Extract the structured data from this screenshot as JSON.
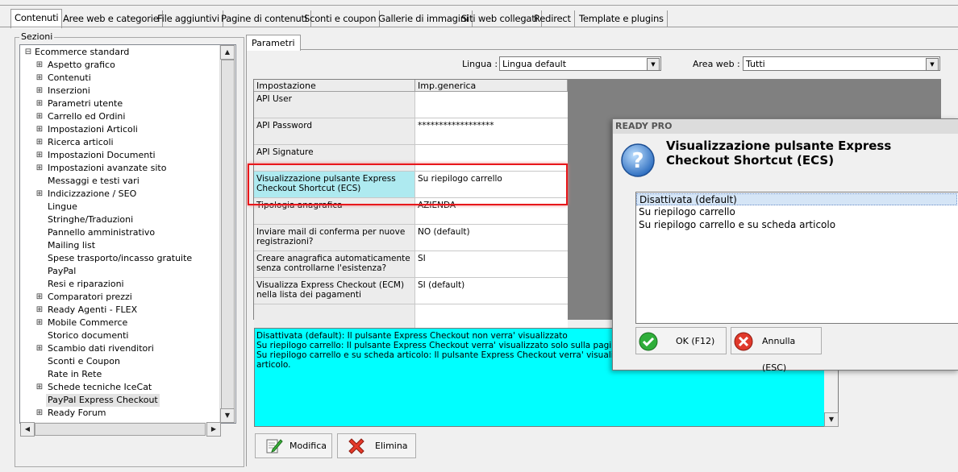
{
  "tabs": [
    "Contenuti",
    "Aree web e categorie",
    "File aggiuntivi",
    "Pagine di contenuti",
    "Sconti e coupon",
    "Gallerie di immagini",
    "Siti web collegati",
    "Redirect",
    "Template e plugins"
  ],
  "sections": {
    "label": "Sezioni",
    "root": "Ecommerce standard",
    "items": [
      {
        "label": "Aspetto grafico",
        "expandable": true
      },
      {
        "label": "Contenuti",
        "expandable": true
      },
      {
        "label": "Inserzioni",
        "expandable": true
      },
      {
        "label": "Parametri utente",
        "expandable": true
      },
      {
        "label": "Carrello ed Ordini",
        "expandable": true
      },
      {
        "label": "Impostazioni Articoli",
        "expandable": true
      },
      {
        "label": "Ricerca articoli",
        "expandable": true
      },
      {
        "label": "Impostazioni Documenti",
        "expandable": true
      },
      {
        "label": "Impostazioni avanzate sito",
        "expandable": true
      },
      {
        "label": "Messaggi e testi vari",
        "expandable": false
      },
      {
        "label": "Indicizzazione / SEO",
        "expandable": true
      },
      {
        "label": "Lingue",
        "expandable": false
      },
      {
        "label": "Stringhe/Traduzioni",
        "expandable": false
      },
      {
        "label": "Pannello amministrativo",
        "expandable": false
      },
      {
        "label": "Mailing list",
        "expandable": false
      },
      {
        "label": "Spese trasporto/incasso gratuite",
        "expandable": false
      },
      {
        "label": "PayPal",
        "expandable": false
      },
      {
        "label": "Resi e riparazioni",
        "expandable": false
      },
      {
        "label": "Comparatori prezzi",
        "expandable": true
      },
      {
        "label": "Ready Agenti - FLEX",
        "expandable": true
      },
      {
        "label": "Mobile Commerce",
        "expandable": true
      },
      {
        "label": "Storico documenti",
        "expandable": false
      },
      {
        "label": "Scambio dati rivenditori",
        "expandable": true
      },
      {
        "label": "Sconti e Coupon",
        "expandable": false
      },
      {
        "label": "Rate in Rete",
        "expandable": false
      },
      {
        "label": "Schede tecniche IceCat",
        "expandable": true
      },
      {
        "label": "PayPal Express Checkout",
        "expandable": false,
        "selected": true
      },
      {
        "label": "Ready Forum",
        "expandable": true
      }
    ]
  },
  "panel": {
    "tab": "Parametri",
    "lingua_label": "Lingua :",
    "lingua_value": "Lingua default",
    "area_label": "Area web :",
    "area_value": "Tutti"
  },
  "grid": {
    "headers": [
      "Impostazione",
      "Imp.generica"
    ],
    "rows": [
      {
        "name": "API User",
        "value": ""
      },
      {
        "name": "API Password",
        "value": "******************"
      },
      {
        "name": "API Signature",
        "value": ""
      },
      {
        "name": "Visualizzazione pulsante Express Checkout Shortcut (ECS)",
        "value": "Su riepilogo carrello",
        "selected": true
      },
      {
        "name": "Tipologia anagrafica",
        "value": "AZIENDA"
      },
      {
        "name": "Inviare mail di conferma per nuove registrazioni?",
        "value": "NO (default)"
      },
      {
        "name": "Creare anagrafica automaticamente senza controllarne l'esistenza?",
        "value": "SI"
      },
      {
        "name": "Visualizza Express Checkout (ECM) nella lista dei pagamenti",
        "value": "SI (default)"
      },
      {
        "name": "",
        "value": ""
      }
    ]
  },
  "memo": {
    "lines": [
      "Disattivata (default): Il pulsante Express Checkout non verra' visualizzato",
      "Su riepilogo carrello: Il pulsante Express Checkout verra' visualizzato solo sulla pagina di riep",
      "Su riepilogo carrello e su scheda articolo: Il pulsante Express Checkout verra' visualizzato so",
      "articolo."
    ]
  },
  "buttons": {
    "modifica": "Modifica",
    "elimina": "Elimina"
  },
  "dialog": {
    "title": "READY PRO",
    "heading": "Visualizzazione pulsante Express Checkout Shortcut (ECS)",
    "options": [
      "Disattivata (default)",
      "Su riepilogo carrello",
      "Su riepilogo carrello e su scheda articolo"
    ],
    "selected_index": 0,
    "ok": "OK (F12)",
    "cancel": "Annulla (ESC)"
  },
  "colors": {
    "highlight": "#e8171b",
    "memo_bg": "#00ffff",
    "selected_row": "#aeeaf0"
  }
}
